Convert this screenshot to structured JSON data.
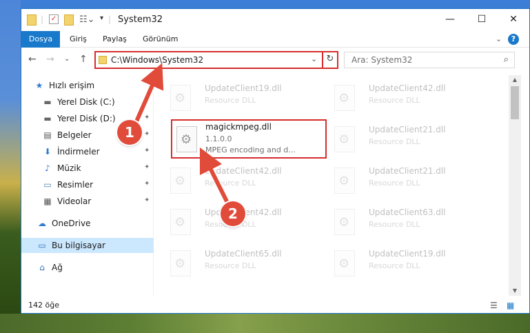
{
  "window": {
    "title": "System32",
    "minimize": "—",
    "maximize": "☐",
    "close": "✕"
  },
  "ribbon": {
    "tabs": [
      "Dosya",
      "Giriş",
      "Paylaş",
      "Görünüm"
    ],
    "expand": "⌄",
    "help": "?"
  },
  "nav": {
    "back": "←",
    "forward": "→",
    "recent": "⌄",
    "up": "↑",
    "address": "C:\\Windows\\System32",
    "address_dropdown": "⌄",
    "refresh": "↻",
    "search_placeholder": "Ara: System32",
    "search_icon": "⌕"
  },
  "sidebar": {
    "items": [
      {
        "label": "Hızlı erişim",
        "icon": "star-icon",
        "glyph": "★",
        "pinned": false
      },
      {
        "label": "Yerel Disk (C:)",
        "icon": "drive-icon",
        "glyph": "▬",
        "pinned": true
      },
      {
        "label": "Yerel Disk (D:)",
        "icon": "drive-icon",
        "glyph": "▬",
        "pinned": true
      },
      {
        "label": "Belgeler",
        "icon": "documents-icon",
        "glyph": "▤",
        "pinned": true
      },
      {
        "label": "İndirmeler",
        "icon": "download-icon",
        "glyph": "⬇",
        "pinned": true
      },
      {
        "label": "Müzik",
        "icon": "music-icon",
        "glyph": "♪",
        "pinned": true
      },
      {
        "label": "Resimler",
        "icon": "pictures-icon",
        "glyph": "▭",
        "pinned": true
      },
      {
        "label": "Videolar",
        "icon": "video-icon",
        "glyph": "▦",
        "pinned": true
      },
      {
        "label": "OneDrive",
        "icon": "cloud-icon",
        "glyph": "☁",
        "pinned": false
      },
      {
        "label": "Bu bilgisayar",
        "icon": "computer-icon",
        "glyph": "▭",
        "pinned": false
      },
      {
        "label": "Ağ",
        "icon": "network-icon",
        "glyph": "⌂",
        "pinned": false
      }
    ],
    "pin_glyph": "📌"
  },
  "files": {
    "left": [
      {
        "name": "UpdateClient19.dll",
        "type": "Resource DLL"
      },
      {
        "name": "magickmpeg.dll",
        "version": "1.1.0.0",
        "desc": "MPEG encoding and d..."
      },
      {
        "name": "UpdateClient42.dll",
        "type": "Resource DLL"
      },
      {
        "name": "UpdateClient42.dll",
        "type": "Resource DLL"
      },
      {
        "name": "UpdateClient65.dll",
        "type": "Resource DLL"
      }
    ],
    "right": [
      {
        "name": "UpdateClient42.dll",
        "type": "Resource DLL"
      },
      {
        "name": "UpdateClient21.dll",
        "type": "Resource DLL"
      },
      {
        "name": "UpdateClient21.dll",
        "type": "Resource DLL"
      },
      {
        "name": "UpdateClient63.dll",
        "type": "Resource DLL"
      },
      {
        "name": "UpdateClient19.dll",
        "type": "Resource DLL"
      }
    ]
  },
  "status": {
    "count": "142 öğe",
    "details_view": "☰",
    "large_view": "▦"
  },
  "callouts": [
    "1",
    "2"
  ],
  "colors": {
    "accent": "#1979ca",
    "highlight_red": "#d62c2c",
    "callout": "#e14b3a"
  }
}
